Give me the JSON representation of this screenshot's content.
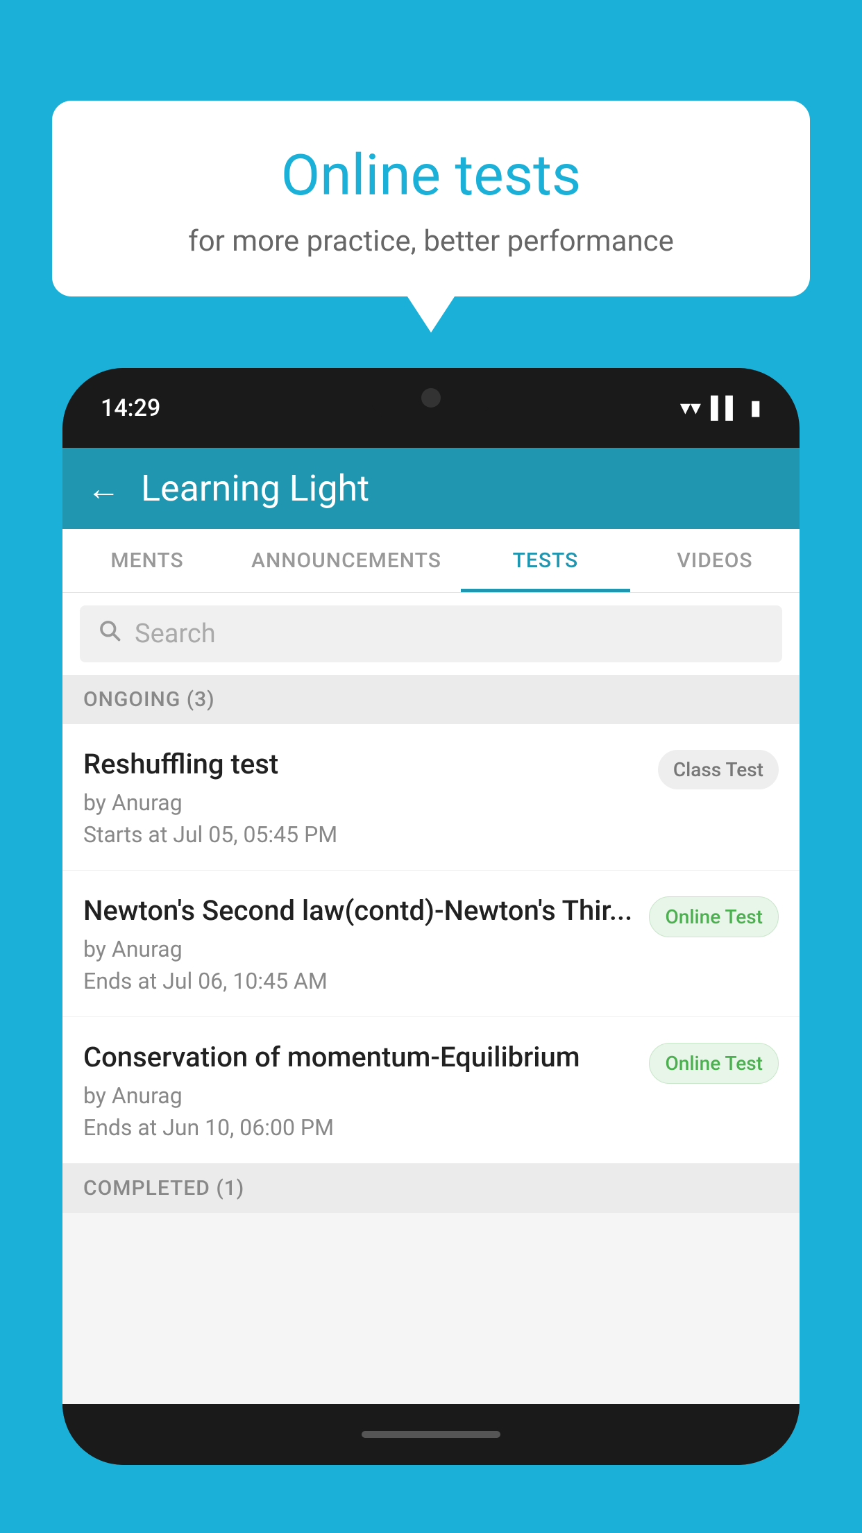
{
  "background": {
    "color": "#1ab0d8"
  },
  "speech_bubble": {
    "title": "Online tests",
    "subtitle": "for more practice, better performance"
  },
  "phone": {
    "status_bar": {
      "time": "14:29",
      "icons": [
        "wifi",
        "signal",
        "battery"
      ]
    },
    "header": {
      "back_label": "←",
      "title": "Learning Light"
    },
    "tabs": [
      {
        "label": "MENTS",
        "active": false
      },
      {
        "label": "ANNOUNCEMENTS",
        "active": false
      },
      {
        "label": "TESTS",
        "active": true
      },
      {
        "label": "VIDEOS",
        "active": false
      }
    ],
    "search": {
      "placeholder": "Search"
    },
    "ongoing_section": {
      "label": "ONGOING (3)"
    },
    "test_items": [
      {
        "title": "Reshuffling test",
        "author": "by Anurag",
        "date": "Starts at  Jul 05, 05:45 PM",
        "badge": "Class Test",
        "badge_type": "class"
      },
      {
        "title": "Newton's Second law(contd)-Newton's Thir...",
        "author": "by Anurag",
        "date": "Ends at  Jul 06, 10:45 AM",
        "badge": "Online Test",
        "badge_type": "online"
      },
      {
        "title": "Conservation of momentum-Equilibrium",
        "author": "by Anurag",
        "date": "Ends at  Jun 10, 06:00 PM",
        "badge": "Online Test",
        "badge_type": "online"
      }
    ],
    "completed_section": {
      "label": "COMPLETED (1)"
    }
  }
}
